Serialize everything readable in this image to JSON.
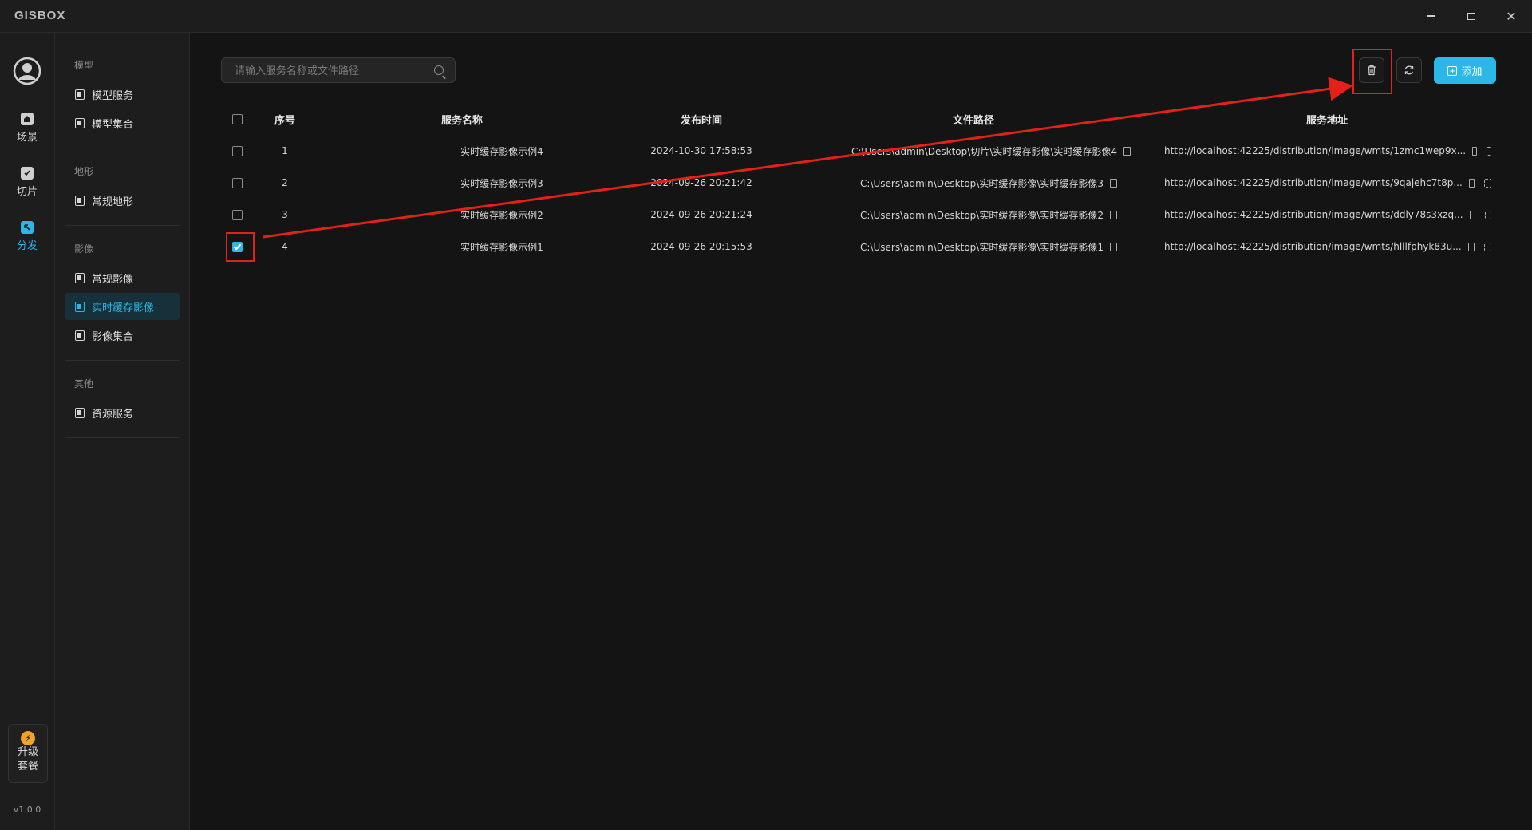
{
  "app": {
    "logo": "GISBOX",
    "version": "v1.0.0"
  },
  "rail": [
    {
      "label": "场景",
      "icon": "home-icon"
    },
    {
      "label": "切片",
      "icon": "tile-icon"
    },
    {
      "label": "分发",
      "icon": "distribute-icon",
      "active": true
    }
  ],
  "upgrade": {
    "line1": "升级",
    "line2": "套餐"
  },
  "sidebar": {
    "sections": [
      {
        "title": "模型",
        "items": [
          "模型服务",
          "模型集合"
        ]
      },
      {
        "title": "地形",
        "items": [
          "常规地形"
        ]
      },
      {
        "title": "影像",
        "items": [
          "常规影像",
          "实时缓存影像",
          "影像集合"
        ]
      },
      {
        "title": "其他",
        "items": [
          "资源服务"
        ]
      }
    ],
    "active_item": "实时缓存影像"
  },
  "toolbar": {
    "search_placeholder": "请输入服务名称或文件路径",
    "add_label": "添加"
  },
  "table": {
    "headers": [
      "序号",
      "服务名称",
      "发布时间",
      "文件路径",
      "服务地址"
    ],
    "rows": [
      {
        "index": "1",
        "name": "实时缓存影像示例4",
        "time": "2024-10-30 17:58:53",
        "path": "C:\\Users\\admin\\Desktop\\切片\\实时缓存影像\\实时缓存影像4",
        "url": "http://localhost:42225/distribution/image/wmts/1zmc1wep9x...",
        "checked": false
      },
      {
        "index": "2",
        "name": "实时缓存影像示例3",
        "time": "2024-09-26 20:21:42",
        "path": "C:\\Users\\admin\\Desktop\\实时缓存影像\\实时缓存影像3",
        "url": "http://localhost:42225/distribution/image/wmts/9qajehc7t8p...",
        "checked": false
      },
      {
        "index": "3",
        "name": "实时缓存影像示例2",
        "time": "2024-09-26 20:21:24",
        "path": "C:\\Users\\admin\\Desktop\\实时缓存影像\\实时缓存影像2",
        "url": "http://localhost:42225/distribution/image/wmts/ddly78s3xzq...",
        "checked": false
      },
      {
        "index": "4",
        "name": "实时缓存影像示例1",
        "time": "2024-09-26 20:15:53",
        "path": "C:\\Users\\admin\\Desktop\\实时缓存影像\\实时缓存影像1",
        "url": "http://localhost:42225/distribution/image/wmts/hlllfphyk83u...",
        "checked": true
      }
    ]
  },
  "colors": {
    "accent": "#2bb7e8",
    "annotation_red": "#e32119",
    "background": "#141414"
  }
}
